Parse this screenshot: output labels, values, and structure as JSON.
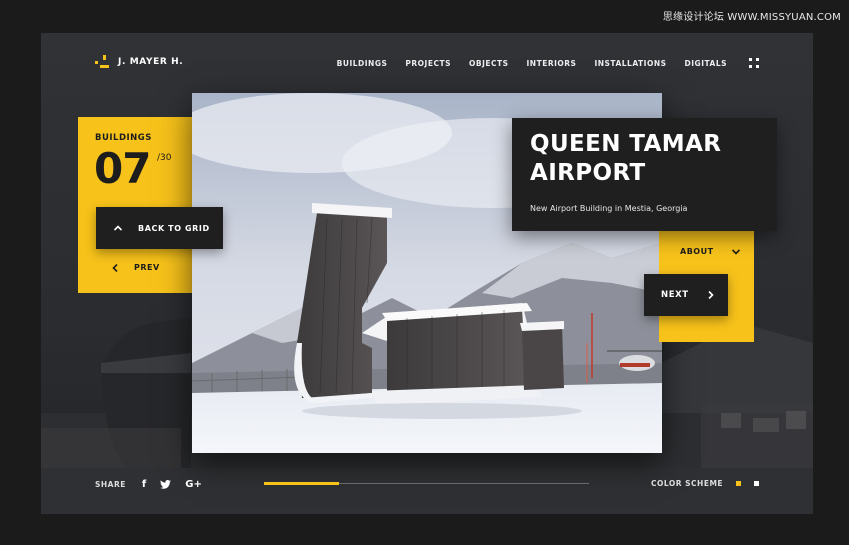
{
  "watermark": "思缘设计论坛 WWW.MISSYUAN.COM",
  "brand": {
    "name": "J. MAYER H."
  },
  "nav": {
    "items": [
      {
        "label": "BUILDINGS"
      },
      {
        "label": "PROJECTS"
      },
      {
        "label": "OBJECTS"
      },
      {
        "label": "INTERIORS"
      },
      {
        "label": "INSTALLATIONS"
      },
      {
        "label": "DIGITALS"
      }
    ]
  },
  "counter": {
    "category": "BUILDINGS",
    "current": "07",
    "total": "/30",
    "current_value": 7,
    "total_value": 30
  },
  "buttons": {
    "back": "BACK TO GRID",
    "prev": "PREV",
    "about": "ABOUT",
    "next": "NEXT"
  },
  "project": {
    "title": "QUEEN TAMAR AIRPORT",
    "subtitle": "New Airport Building in Mestia, Georgia"
  },
  "footer": {
    "share_label": "SHARE",
    "social": {
      "facebook": "f",
      "twitter": "twitter-icon",
      "google": "G+"
    },
    "progress": 0.23,
    "color_scheme_label": "COLOR SCHEME",
    "swatches": [
      "#f7c21a",
      "#ffffff"
    ]
  },
  "colors": {
    "accent": "#f7c21a",
    "dark": "#1f1f1f",
    "frame": "#2b2d31"
  }
}
